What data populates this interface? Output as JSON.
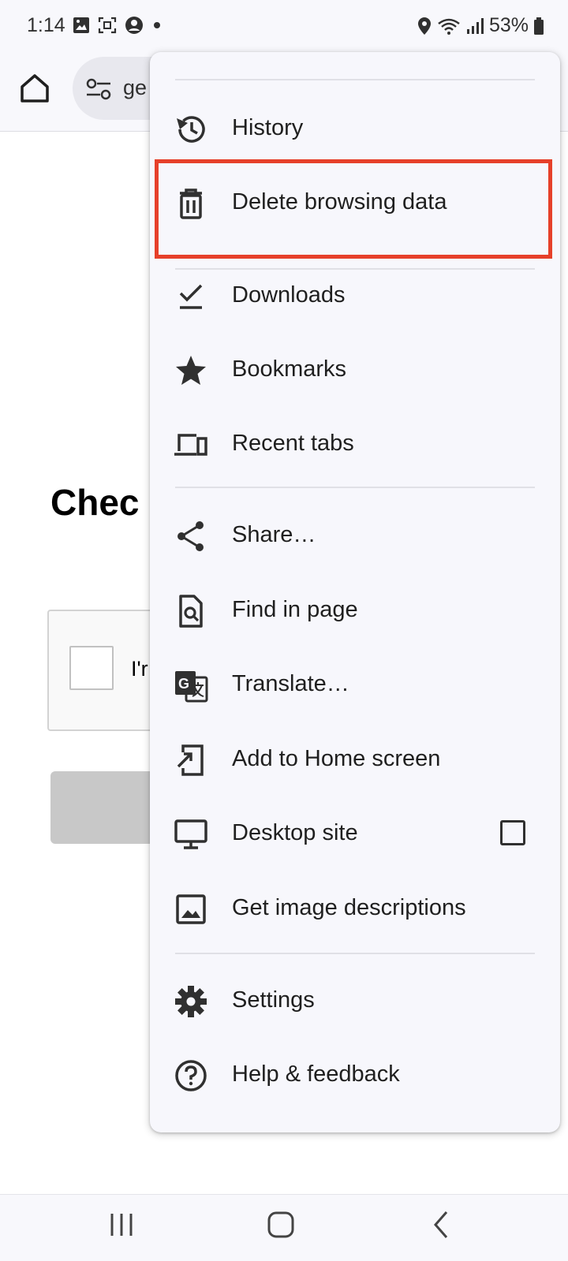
{
  "status_bar": {
    "time": "1:14",
    "battery": "53%",
    "icons": [
      "gallery-icon",
      "screenshot-icon",
      "account-icon",
      "dot-icon",
      "location-icon",
      "wifi-icon",
      "signal-icon",
      "battery-icon"
    ]
  },
  "toolbar": {
    "url_text": "ge",
    "home_icon": "home-icon",
    "tune_icon": "tune-icon"
  },
  "page": {
    "heading": "Chec",
    "captcha_label": "I'r"
  },
  "menu": {
    "items": [
      {
        "label": "History",
        "icon": "history-icon"
      },
      {
        "label": "Delete browsing data",
        "icon": "trash-icon"
      },
      {
        "label": "Downloads",
        "icon": "download-done-icon"
      },
      {
        "label": "Bookmarks",
        "icon": "star-icon"
      },
      {
        "label": "Recent tabs",
        "icon": "devices-icon"
      },
      {
        "label": "Share…",
        "icon": "share-icon"
      },
      {
        "label": "Find in page",
        "icon": "find-in-page-icon"
      },
      {
        "label": "Translate…",
        "icon": "translate-icon"
      },
      {
        "label": "Add to Home screen",
        "icon": "add-to-home-icon"
      },
      {
        "label": "Desktop site",
        "icon": "desktop-icon",
        "checked": false
      },
      {
        "label": "Get image descriptions",
        "icon": "image-icon"
      },
      {
        "label": "Settings",
        "icon": "gear-icon"
      },
      {
        "label": "Help & feedback",
        "icon": "help-icon"
      }
    ]
  },
  "colors": {
    "highlight": "#e6402a",
    "menu_bg": "#f7f7fc",
    "text": "#1f1f1f"
  }
}
